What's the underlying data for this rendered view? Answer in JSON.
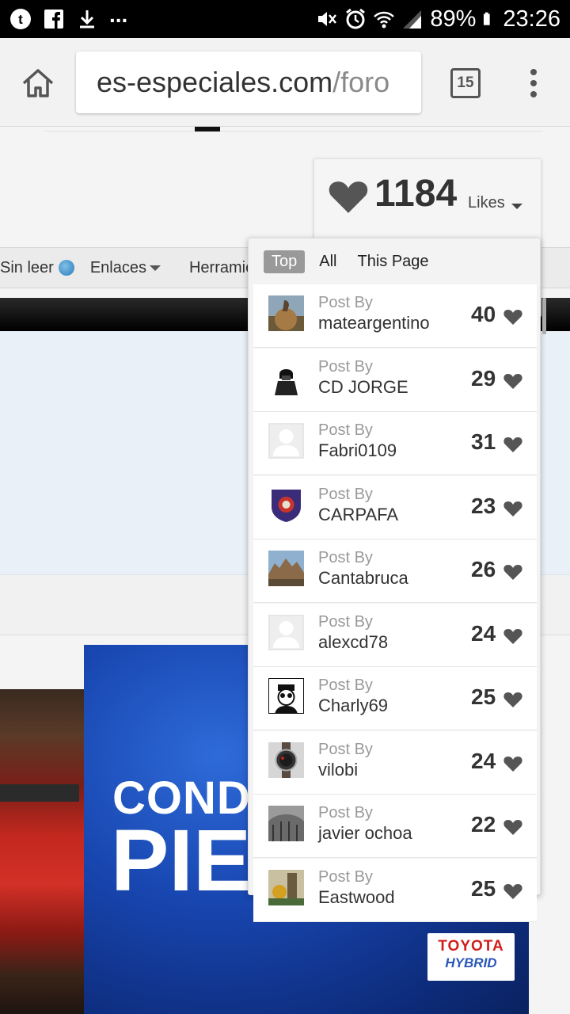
{
  "status_bar": {
    "battery": "89%",
    "time": "23:26",
    "ellipsis": "...",
    "icons": [
      "tumblr-icon",
      "facebook-icon",
      "download-icon",
      "mute-icon",
      "alarm-icon",
      "wifi-icon",
      "signal-icon",
      "battery-icon"
    ]
  },
  "browser": {
    "url_host": "es-especiales.com",
    "url_path": "/foro",
    "tab_count": "15",
    "icons": [
      "home-icon",
      "tabs-icon",
      "more-icon"
    ]
  },
  "forum_nav": {
    "items": [
      {
        "label": "Sin leer"
      },
      {
        "label": "Enlaces"
      },
      {
        "label": "Herramie"
      }
    ]
  },
  "ad": {
    "line1": "COND",
    "line2": "PIE",
    "brand": "TOYOTA",
    "sub": "HYBRID"
  },
  "likes": {
    "count": "1184",
    "label": "Likes",
    "tabs": [
      {
        "label": "Top",
        "active": true
      },
      {
        "label": "All",
        "active": false
      },
      {
        "label": "This Page",
        "active": false
      }
    ],
    "posts": [
      {
        "prefix": "Post By",
        "user": "mateargentino",
        "count": "40",
        "avatar": "bird"
      },
      {
        "prefix": "Post By",
        "user": "CD JORGE",
        "count": "29",
        "avatar": "vader"
      },
      {
        "prefix": "Post By",
        "user": "Fabri0109",
        "count": "31",
        "avatar": "default"
      },
      {
        "prefix": "Post By",
        "user": "CARPAFA",
        "count": "23",
        "avatar": "shield"
      },
      {
        "prefix": "Post By",
        "user": "Cantabruca",
        "count": "26",
        "avatar": "landscape"
      },
      {
        "prefix": "Post By",
        "user": "alexcd78",
        "count": "24",
        "avatar": "default"
      },
      {
        "prefix": "Post By",
        "user": "Charly69",
        "count": "25",
        "avatar": "cartoon"
      },
      {
        "prefix": "Post By",
        "user": "vilobi",
        "count": "24",
        "avatar": "watch"
      },
      {
        "prefix": "Post By",
        "user": "javier ochoa",
        "count": "22",
        "avatar": "bridge"
      },
      {
        "prefix": "Post By",
        "user": "Eastwood",
        "count": "25",
        "avatar": "tower"
      }
    ]
  },
  "colors": {
    "accent_grey": "#999999",
    "heart": "#555555",
    "text": "#333333"
  }
}
